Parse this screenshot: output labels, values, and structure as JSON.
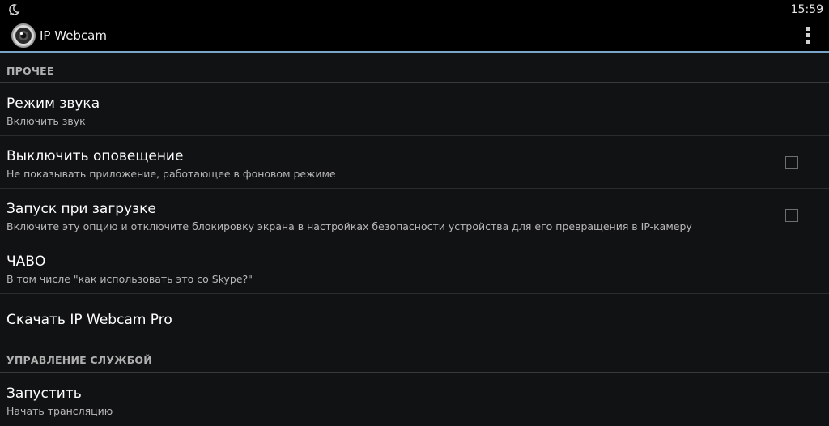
{
  "status_bar": {
    "time": "15:59",
    "notification_icon": "moon-icon"
  },
  "action_bar": {
    "title": "IP Webcam",
    "app_icon": "webcam-icon",
    "menu_icon": "overflow-menu-icon",
    "accent_color": "#7aa5c8"
  },
  "sections": [
    {
      "header": "ПРОЧЕЕ",
      "items": [
        {
          "title": "Режим звука",
          "summary": "Включить звук",
          "checkbox": false
        },
        {
          "title": "Выключить оповещение",
          "summary": "Не показывать приложение, работающее в фоновом режиме",
          "checkbox": true,
          "checked": false
        },
        {
          "title": "Запуск при загрузке",
          "summary": "Включите эту опцию и отключите блокировку экрана в настройках безопасности устройства для его превращения в IP-камеру",
          "checkbox": true,
          "checked": false
        },
        {
          "title": "ЧАВО",
          "summary": "В том числе \"как использовать это со Skype?\"",
          "checkbox": false
        },
        {
          "title": "Скачать IP Webcam Pro",
          "summary": "",
          "checkbox": false
        }
      ]
    },
    {
      "header": "УПРАВЛЕНИЕ СЛУЖБОЙ",
      "items": [
        {
          "title": "Запустить",
          "summary": "Начать трансляцию",
          "checkbox": false
        }
      ]
    }
  ]
}
